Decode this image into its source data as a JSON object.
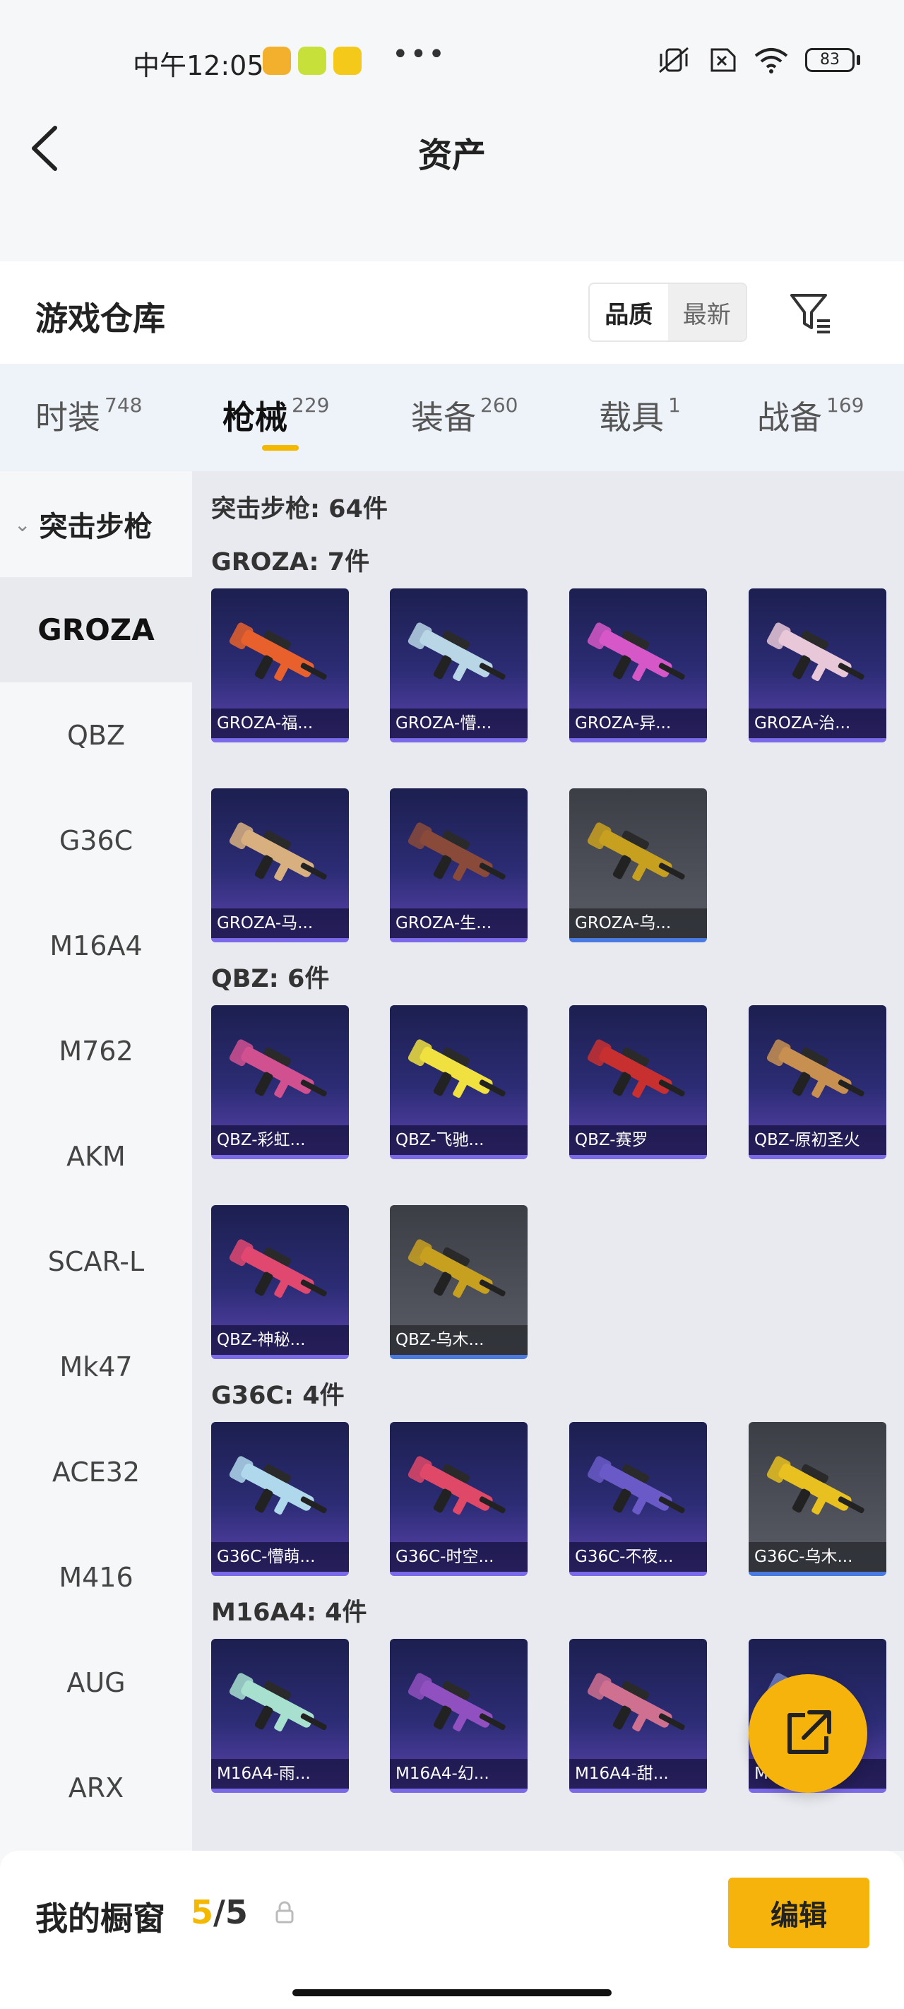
{
  "status_bar": {
    "time": "中午12:05",
    "dots": "•••",
    "battery": "83",
    "app_icons": [
      "#f3b02c",
      "#c8e03a",
      "#f5c91a"
    ]
  },
  "header": {
    "title": "资产",
    "back_icon": "chevron-left-icon"
  },
  "warehouse": {
    "title": "游戏仓库",
    "sort_options": [
      {
        "label": "品质",
        "active": true
      },
      {
        "label": "最新",
        "active": false
      }
    ],
    "filter_icon": "filter-icon"
  },
  "tabs": [
    {
      "label": "时装",
      "count": "748",
      "active": false
    },
    {
      "label": "枪械",
      "count": "229",
      "active": true
    },
    {
      "label": "装备",
      "count": "260",
      "active": false
    },
    {
      "label": "载具",
      "count": "1",
      "active": false
    },
    {
      "label": "战备",
      "count": "169",
      "active": false
    }
  ],
  "sidebar": {
    "group": "突击步枪",
    "items": [
      "GROZA",
      "QBZ",
      "G36C",
      "M16A4",
      "M762",
      "AKM",
      "SCAR-L",
      "Mk47",
      "ACE32",
      "M416",
      "AUG",
      "ARX"
    ],
    "active_index": 0
  },
  "content": {
    "summary": "突击步枪: 64件",
    "sections": [
      {
        "title": "GROZA: 7件",
        "items": [
          {
            "name": "GROZA-福...",
            "color": "#e8602c",
            "grey": false
          },
          {
            "name": "GROZA-懵...",
            "color": "#b8d6e6",
            "grey": false
          },
          {
            "name": "GROZA-异...",
            "color": "#d658c8",
            "grey": false
          },
          {
            "name": "GROZA-治...",
            "color": "#e8c8d8",
            "grey": false
          },
          {
            "name": "GROZA-马...",
            "color": "#d8b080",
            "grey": false
          },
          {
            "name": "GROZA-生...",
            "color": "#8a4a3a",
            "grey": false
          },
          {
            "name": "GROZA-乌...",
            "color": "#c8a020",
            "grey": true
          }
        ]
      },
      {
        "title": "QBZ: 6件",
        "items": [
          {
            "name": "QBZ-彩虹...",
            "color": "#d05090",
            "grey": false
          },
          {
            "name": "QBZ-飞驰...",
            "color": "#f0e040",
            "grey": false
          },
          {
            "name": "QBZ-赛罗",
            "color": "#c83030",
            "grey": false
          },
          {
            "name": "QBZ-原初圣火",
            "color": "#c89050",
            "grey": false
          },
          {
            "name": "QBZ-神秘...",
            "color": "#e04870",
            "grey": false
          },
          {
            "name": "QBZ-乌木...",
            "color": "#c8a020",
            "grey": true
          }
        ]
      },
      {
        "title": "G36C: 4件",
        "items": [
          {
            "name": "G36C-懵萌...",
            "color": "#b0d8ec",
            "grey": false
          },
          {
            "name": "G36C-时空...",
            "color": "#e04868",
            "grey": false
          },
          {
            "name": "G36C-不夜...",
            "color": "#6a5ac8",
            "grey": false
          },
          {
            "name": "G36C-乌木...",
            "color": "#e8c020",
            "grey": true
          }
        ]
      },
      {
        "title": "M16A4: 4件",
        "items": [
          {
            "name": "M16A4-雨...",
            "color": "#a8e0d0",
            "grey": false
          },
          {
            "name": "M16A4-幻...",
            "color": "#9050c0",
            "grey": false
          },
          {
            "name": "M16A4-甜...",
            "color": "#d07090",
            "grey": false
          },
          {
            "name": "M16A4-机...",
            "color": "#7080c8",
            "grey": false
          }
        ]
      }
    ]
  },
  "fab_icon": "share-icon",
  "bottom_bar": {
    "title": "我的橱窗",
    "count_current": "5",
    "count_sep_total": "/5",
    "lock_icon": "lock-icon",
    "edit_label": "编辑"
  },
  "colors": {
    "accent": "#f6b30b",
    "card_top": "#1c1f4f",
    "card_bottom": "#5b44ae"
  }
}
